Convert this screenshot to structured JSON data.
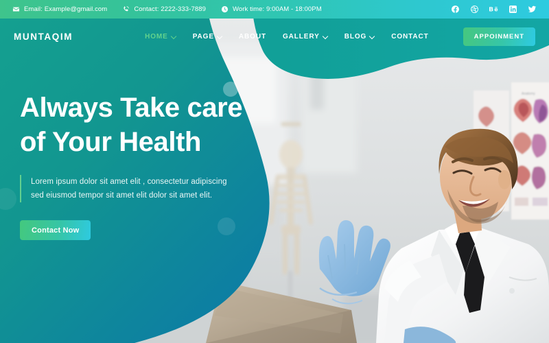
{
  "topbar": {
    "items": [
      {
        "icon": "envelope-icon",
        "text": "Email: Example@gmail.com"
      },
      {
        "icon": "phone-icon",
        "text": "Contact: 2222-333-7889"
      },
      {
        "icon": "clock-icon",
        "text": "Work time: 9:00AM - 18:00PM"
      }
    ],
    "socials": [
      {
        "icon": "facebook-icon",
        "label": "Facebook"
      },
      {
        "icon": "dribbble-icon",
        "label": "Dribbble"
      },
      {
        "icon": "behance-icon",
        "label": "Behance"
      },
      {
        "icon": "linkedin-icon",
        "label": "LinkedIn"
      },
      {
        "icon": "twitter-icon",
        "label": "Twitter"
      }
    ],
    "gradient_from": "#3fc48c",
    "gradient_to": "#2ecbe0"
  },
  "navbar": {
    "brand": "MUNTAQIM",
    "items": [
      {
        "label": "HOME",
        "dropdown": true,
        "active": true
      },
      {
        "label": "PAGE",
        "dropdown": true,
        "active": false
      },
      {
        "label": "ABOUT",
        "dropdown": false,
        "active": false
      },
      {
        "label": "GALLERY",
        "dropdown": true,
        "active": false
      },
      {
        "label": "BLOG",
        "dropdown": true,
        "active": false
      },
      {
        "label": "CONTACT",
        "dropdown": false,
        "active": false
      }
    ],
    "cta_label": "APPOINMENT",
    "active_color": "#62d38c"
  },
  "hero": {
    "title_line1": "Always Take care",
    "title_line2": "of Your Health",
    "paragraph_line1": "Lorem ipsum dolor sit amet elit , consectetur adipiscing",
    "paragraph_line2": "sed eiusmod tempor sit amet elit dolor sit amet elit.",
    "button_label": "Contact Now",
    "accent_color": "#63d08f",
    "overlay_from": "#169b8d",
    "overlay_to": "#0d7fa3"
  }
}
